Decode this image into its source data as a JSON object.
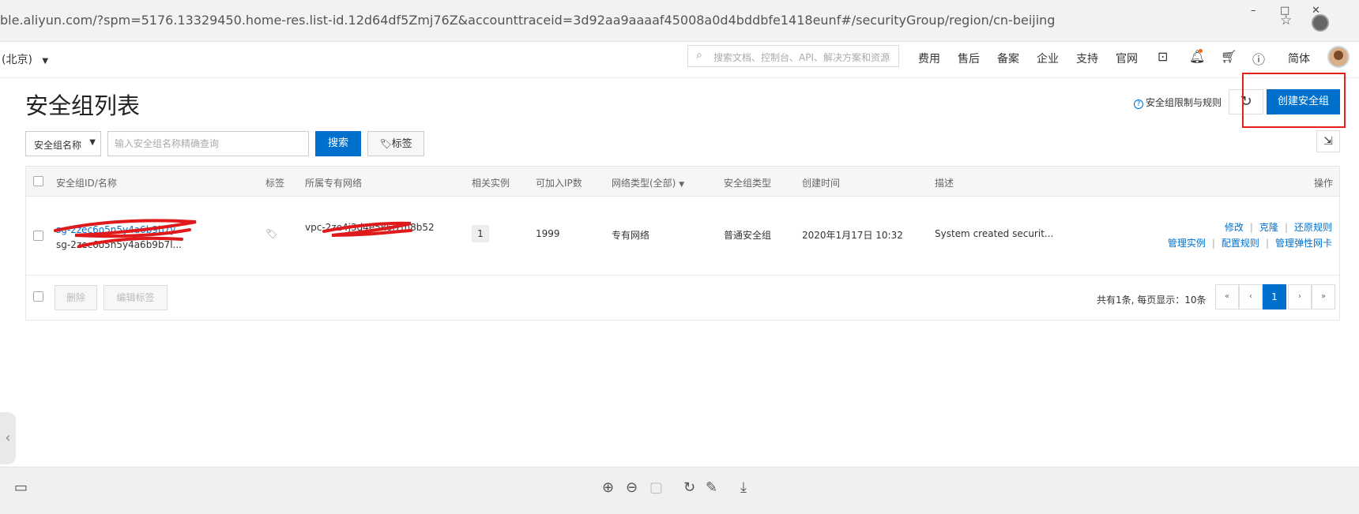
{
  "browser": {
    "url": "ble.aliyun.com/?spm=5176.13329450.home-res.list-id.12d64df5Zmj76Z&accounttraceid=3d92aa9aaaaf45008a0d4bddbfe1418eunf#/securityGroup/region/cn-beijing",
    "minimize": "–",
    "maximize": "□",
    "close": "✕",
    "star_icon": "☆"
  },
  "nav": {
    "region": "(北京)",
    "search_placeholder": "搜索文档、控制台、API、解决方案和资源",
    "items": [
      "费用",
      "售后",
      "备案",
      "企业",
      "支持",
      "官网"
    ],
    "lang": "简体"
  },
  "page": {
    "title": "安全组列表",
    "limit_link": "安全组限制与规则",
    "refresh_icon": "↻",
    "create_button": "创建安全组",
    "export_icon": "⇲"
  },
  "filter": {
    "select_value": "安全组名称",
    "input_placeholder": "输入安全组名称精确查询",
    "search_button": "搜索",
    "tag_button": "标签"
  },
  "table": {
    "headers": {
      "id_name": "安全组ID/名称",
      "tag": "标签",
      "vpc": "所属专有网络",
      "instances": "相关实例",
      "ips": "可加入IP数",
      "net_type": "网络类型(全部)",
      "sg_type": "安全组类型",
      "created": "创建时间",
      "desc": "描述",
      "ops": "操作"
    },
    "rows": [
      {
        "id": "sg-2zec6o5n5y4a6b9b7y",
        "name": "sg-2zec6o5n5y4a6b9b7l...",
        "vpc": "vpc-2ze4j3d4e5k6l7m8b52",
        "instances": "1",
        "ips": "1999",
        "net_type": "专有网络",
        "sg_type": "普通安全组",
        "created": "2020年1月17日 10:32",
        "desc": "System created securit...",
        "ops_row1": [
          "修改",
          "克隆",
          "还原规则"
        ],
        "ops_row2": [
          "管理实例",
          "配置规则",
          "管理弹性网卡"
        ]
      }
    ],
    "footer": {
      "delete": "删除",
      "edit_tags": "编辑标签",
      "summary": "共有1条, 每页显示：10条",
      "pages": [
        "«",
        "‹",
        "1",
        "›",
        "»"
      ]
    }
  },
  "viewer": {
    "zoom_in": "⊕",
    "zoom_out": "⊖",
    "rotate": "↻",
    "edit": "✎",
    "download": "⤓"
  }
}
